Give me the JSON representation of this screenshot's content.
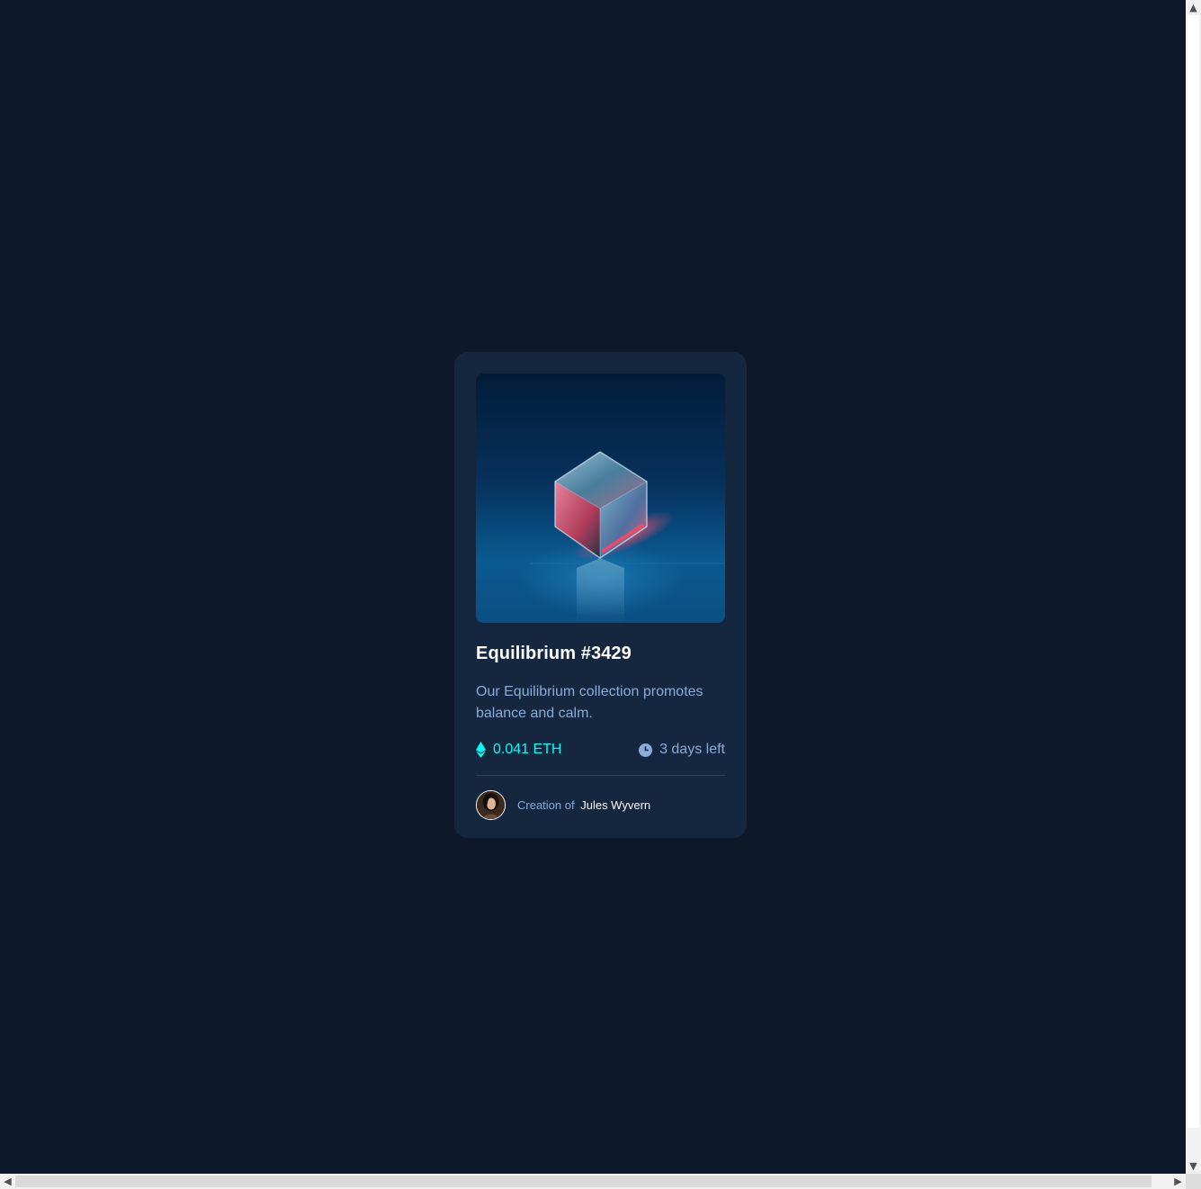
{
  "card": {
    "title": "Equilibrium #3429",
    "description": "Our Equilibrium collection promotes balance and calm.",
    "price": "0.041 ETH",
    "time_left": "3 days left",
    "creator_prefix": "Creation of",
    "creator_name": "Jules Wyvern"
  },
  "icons": {
    "price": "ethereum-icon",
    "time": "clock-icon",
    "hero": "cube-image",
    "avatar": "avatar-image"
  },
  "colors": {
    "page_background": "#0d192b",
    "card_background": "#15263f",
    "accent_cyan": "#00fff8",
    "soft_blue": "#8bacd9",
    "white": "#ffffff",
    "divider": "#2e405a"
  },
  "scrollbars": {
    "up_arrow": "▲",
    "down_arrow": "▼",
    "left_arrow": "◀",
    "right_arrow": "▶"
  }
}
